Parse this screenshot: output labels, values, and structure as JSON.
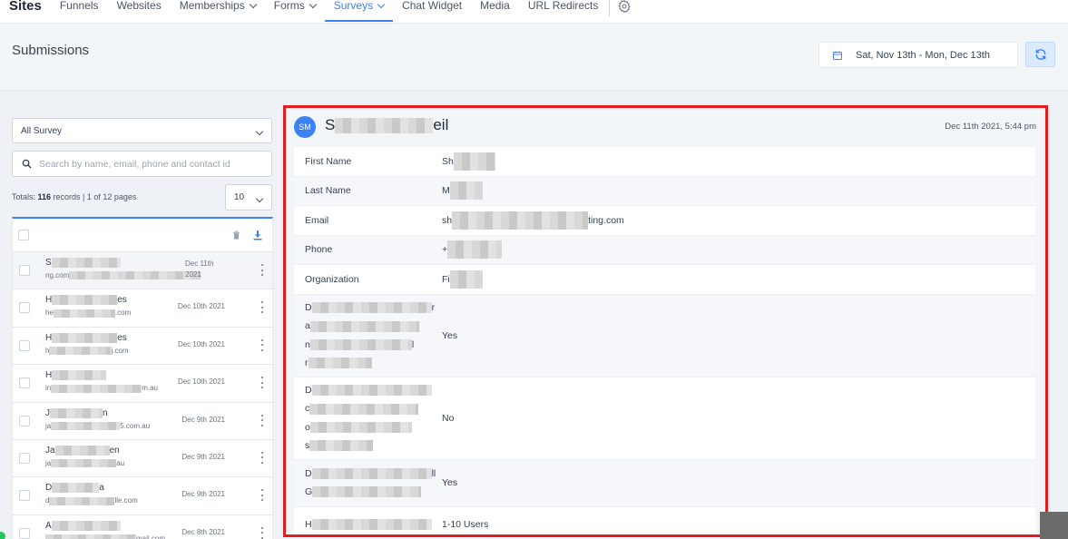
{
  "nav": {
    "brand": "Sites",
    "items": [
      {
        "label": "Funnels",
        "dropdown": false,
        "active": false
      },
      {
        "label": "Websites",
        "dropdown": false,
        "active": false
      },
      {
        "label": "Memberships",
        "dropdown": true,
        "active": false
      },
      {
        "label": "Forms",
        "dropdown": true,
        "active": false
      },
      {
        "label": "Surveys",
        "dropdown": true,
        "active": true
      },
      {
        "label": "Chat Widget",
        "dropdown": false,
        "active": false
      },
      {
        "label": "Media",
        "dropdown": false,
        "active": false
      },
      {
        "label": "URL Redirects",
        "dropdown": false,
        "active": false
      }
    ],
    "settings_icon": "gear-icon"
  },
  "header": {
    "title": "Submissions",
    "date_range": "Sat, Nov 13th - Mon, Dec 13th",
    "calendar_icon": "calendar-icon",
    "refresh_icon": "refresh-icon"
  },
  "filters": {
    "survey_select": "All Survey",
    "search_placeholder": "Search by name, email, phone and contact id",
    "totals_prefix": "Totals: ",
    "totals_count": "116",
    "totals_suffix": " records | 1 of 12 pages",
    "page_size": "10"
  },
  "list": {
    "rows": [
      {
        "name": "S",
        "email": "ng.com",
        "date": "Dec 11th 2021",
        "selected": true
      },
      {
        "name": "H",
        "name_end": "es",
        "email": "he",
        "email_end": ".com",
        "date": "Dec 10th 2021",
        "selected": false
      },
      {
        "name": "H",
        "name_end": "es",
        "email": "h",
        "email_end": "j.com",
        "date": "Dec 10th 2021",
        "selected": false
      },
      {
        "name": "H",
        "name_end": "",
        "email": "in",
        "email_end": "m.au",
        "date": "Dec 10th 2021",
        "selected": false
      },
      {
        "name": "J",
        "name_end": "n",
        "email": "ja",
        "email_end": "5.com.au",
        "date": "Dec 9th 2021",
        "selected": false
      },
      {
        "name": "Ja",
        "name_end": "en",
        "email": "ja",
        "email_end": "au",
        "date": "Dec 9th 2021",
        "selected": false
      },
      {
        "name": "D",
        "name_end": "a",
        "email": "d",
        "email_end": "lle.com",
        "date": "Dec 9th 2021",
        "selected": false
      },
      {
        "name": "A",
        "name_end": "",
        "email": "",
        "email_end": "mail.com",
        "date": "Dec 8th 2021",
        "selected": false
      }
    ]
  },
  "detail": {
    "avatar_initials": "SM",
    "name_start": "S",
    "name_end": "eil",
    "timestamp": "Dec 11th 2021, 5:44 pm",
    "fields": [
      {
        "label": "First Name",
        "value_start": "Sh",
        "value_end": ""
      },
      {
        "label": "Last Name",
        "value_start": "M",
        "value_end": ""
      },
      {
        "label": "Email",
        "value_start": "sh",
        "value_end": "ting.com"
      },
      {
        "label": "Phone",
        "value_start": "+",
        "value_end": ""
      },
      {
        "label": "Organization",
        "value_start": "Fi",
        "value_end": ""
      }
    ],
    "questions": [
      {
        "lines": [
          "D",
          "a",
          "n",
          "r"
        ],
        "line_ends": [
          "r",
          "",
          "l",
          ""
        ],
        "answer": "Yes"
      },
      {
        "lines": [
          "D",
          "c",
          "o",
          "s"
        ],
        "line_ends": [
          "",
          "",
          "",
          ""
        ],
        "answer": "No"
      },
      {
        "lines": [
          "D",
          "G"
        ],
        "line_ends": [
          "ll",
          ""
        ],
        "answer": "Yes"
      },
      {
        "lines": [
          "H"
        ],
        "line_ends": [
          ""
        ],
        "answer": "1-10 Users"
      }
    ]
  }
}
